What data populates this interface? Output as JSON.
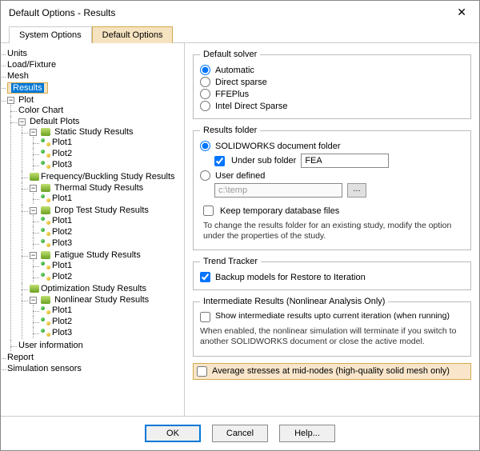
{
  "window": {
    "title": "Default Options - Results"
  },
  "tabs": {
    "system": "System Options",
    "default": "Default Options"
  },
  "tree": {
    "units": "Units",
    "loadFixture": "Load/Fixture",
    "mesh": "Mesh",
    "results": "Results",
    "plot": "Plot",
    "colorChart": "Color Chart",
    "defaultPlots": "Default Plots",
    "staticStudy": "Static Study Results",
    "plot1": "Plot1",
    "plot2": "Plot2",
    "plot3": "Plot3",
    "freqBuckling": "Frequency/Buckling Study Results",
    "thermalStudy": "Thermal Study Results",
    "dropTest": "Drop Test Study Results",
    "fatigue": "Fatigue Study Results",
    "optimization": "Optimization Study Results",
    "nonlinear": "Nonlinear Study Results",
    "userInfo": "User information",
    "report": "Report",
    "simSensors": "Simulation sensors"
  },
  "solver": {
    "legend": "Default solver",
    "automatic": "Automatic",
    "directSparse": "Direct sparse",
    "ffeplus": "FFEPlus",
    "intelDirect": "Intel Direct Sparse"
  },
  "resultsFolder": {
    "legend": "Results folder",
    "swFolder": "SOLIDWORKS document folder",
    "underSub": "Under sub folder",
    "subValue": "FEA",
    "userDefined": "User defined",
    "ctemp": "c:\\temp",
    "keepTemp": "Keep temporary database files",
    "note": "To change the results folder for an existing study, modify the option under the properties of the study."
  },
  "trend": {
    "legend": "Trend Tracker",
    "backup": "Backup models for Restore to Iteration"
  },
  "intermediate": {
    "legend": "Intermediate Results (Nonlinear Analysis Only)",
    "show": "Show intermediate results upto current iteration (when running)",
    "note": "When enabled, the nonlinear simulation will terminate if you switch to another SOLIDWORKS document or close the active model."
  },
  "avgStress": "Average stresses at mid-nodes (high-quality solid mesh only)",
  "buttons": {
    "ok": "OK",
    "cancel": "Cancel",
    "help": "Help..."
  }
}
